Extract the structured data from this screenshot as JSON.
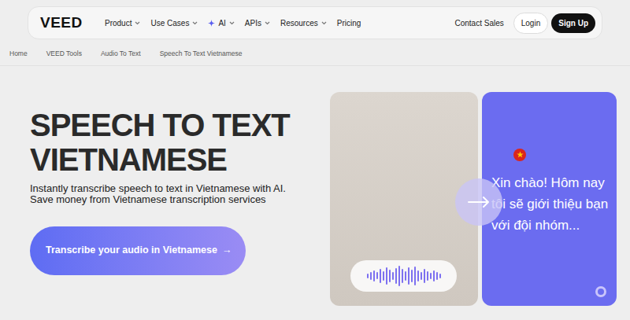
{
  "nav": {
    "logo": "VEED",
    "items": [
      {
        "label": "Product",
        "kind": "plain",
        "has_menu": true
      },
      {
        "label": "Use Cases",
        "kind": "plain",
        "has_menu": true
      },
      {
        "label": "AI",
        "kind": "highlighted",
        "has_menu": true
      },
      {
        "label": "APIs",
        "kind": "plain",
        "has_menu": true
      },
      {
        "label": "Resources",
        "kind": "plain",
        "has_menu": true
      },
      {
        "label": "Pricing",
        "kind": "plain",
        "has_menu": false
      }
    ],
    "contact": "Contact Sales",
    "login": "Login",
    "signup": "Sign Up"
  },
  "breadcrumb": [
    "Home",
    "VEED Tools",
    "Audio To Text",
    "Speech To Text Vietnamese"
  ],
  "hero": {
    "title_lines": [
      "SPEECH TO TEXT",
      "VIETNAMESE"
    ],
    "subtitle": "Instantly transcribe speech to text in Vietnamese with AI. Save money from Vietnamese transcription services",
    "cta": "Transcribe your audio in Vietnamese",
    "cta_arrow": "→"
  },
  "demo": {
    "transcript": "Xin chào! Hôm nay tôi sẽ giới thiệu bạn với đội nhóm..."
  }
}
